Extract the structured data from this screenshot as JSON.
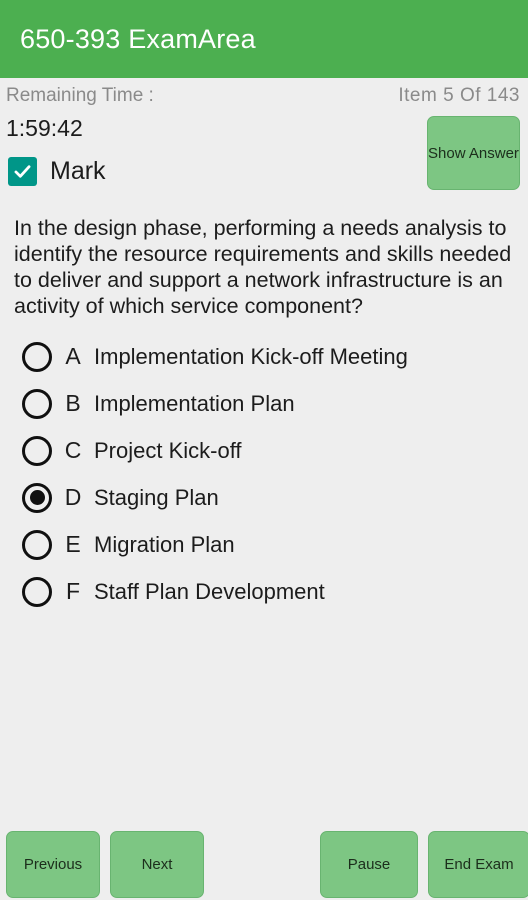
{
  "appbar": {
    "title": "650-393 ExamArea",
    "background_color": "#4caf50",
    "text_color": "#ffffff"
  },
  "status": {
    "remaining_time_label": "Remaining Time :",
    "item_counter": "Item 5 Of 143"
  },
  "timer": {
    "value": "1:59:42"
  },
  "mark": {
    "label": "Mark",
    "checked": true,
    "checkbox_color": "#009688"
  },
  "show_answer": {
    "label": "Show Answer"
  },
  "question": {
    "text": "In the design phase, performing a needs analysis to identify the resource requirements and skills needed to deliver and support a network infrastructure is an activity of which service component?"
  },
  "options": [
    {
      "letter": "A",
      "text": "Implementation Kick-off Meeting",
      "selected": false
    },
    {
      "letter": "B",
      "text": "Implementation Plan",
      "selected": false
    },
    {
      "letter": "C",
      "text": "Project Kick-off",
      "selected": false
    },
    {
      "letter": "D",
      "text": "Staging Plan",
      "selected": true
    },
    {
      "letter": "E",
      "text": "Migration Plan",
      "selected": false
    },
    {
      "letter": "F",
      "text": "Staff Plan Development",
      "selected": false
    }
  ],
  "bottom_buttons": {
    "previous": "Previous",
    "next": "Next",
    "pause": "Pause",
    "end_exam": "End Exam"
  },
  "colors": {
    "accent_green": "#4caf50",
    "button_green": "#7dc683",
    "checkbox_teal": "#009688",
    "page_background": "#eeeeee"
  }
}
